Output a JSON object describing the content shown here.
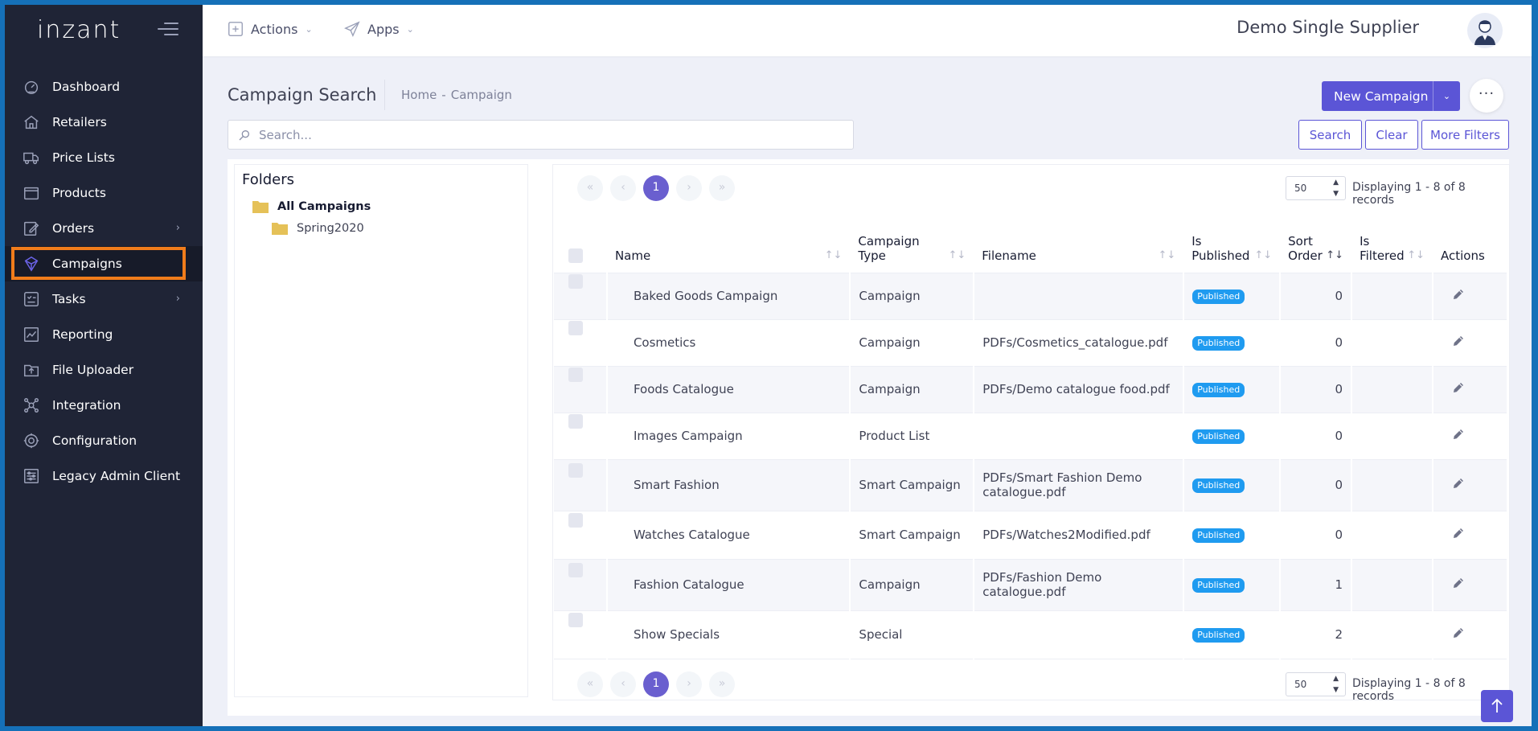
{
  "app": {
    "logo": "inzant"
  },
  "sidebar": {
    "items": [
      {
        "label": "Dashboard",
        "icon": "dashboard-icon",
        "has_sub": false
      },
      {
        "label": "Retailers",
        "icon": "home-icon",
        "has_sub": false
      },
      {
        "label": "Price Lists",
        "icon": "truck-icon",
        "has_sub": false
      },
      {
        "label": "Products",
        "icon": "box-icon",
        "has_sub": false
      },
      {
        "label": "Orders",
        "icon": "edit-icon",
        "has_sub": true
      },
      {
        "label": "Campaigns",
        "icon": "campaign-icon",
        "has_sub": false,
        "active": true
      },
      {
        "label": "Tasks",
        "icon": "tasks-icon",
        "has_sub": true
      },
      {
        "label": "Reporting",
        "icon": "chart-icon",
        "has_sub": false
      },
      {
        "label": "File Uploader",
        "icon": "upload-icon",
        "has_sub": false
      },
      {
        "label": "Integration",
        "icon": "integration-icon",
        "has_sub": false
      },
      {
        "label": "Configuration",
        "icon": "gear-icon",
        "has_sub": false
      },
      {
        "label": "Legacy Admin Client",
        "icon": "sliders-icon",
        "has_sub": false
      }
    ]
  },
  "header": {
    "actions_label": "Actions",
    "apps_label": "Apps",
    "user_name": "Demo Single Supplier"
  },
  "page": {
    "title": "Campaign Search",
    "breadcrumb": [
      "Home",
      "Campaign"
    ],
    "new_button": "New Campaign",
    "more_button": "···",
    "search_placeholder": "Search...",
    "search_button": "Search",
    "clear_button": "Clear",
    "filters_button": "More Filters"
  },
  "folders": {
    "title": "Folders",
    "root": "All Campaigns",
    "children": [
      "Spring2020"
    ]
  },
  "table": {
    "current_page": "1",
    "per_page": "50",
    "records_text": "Displaying 1 - 8 of 8 records",
    "columns": {
      "name": "Name",
      "type": [
        "Campaign",
        "Type"
      ],
      "filename": "Filename",
      "published": [
        "Is",
        "Published"
      ],
      "sort": [
        "Sort",
        "Order"
      ],
      "filtered": [
        "Is",
        "Filtered"
      ],
      "actions": "Actions"
    },
    "rows": [
      {
        "name": "Baked Goods Campaign",
        "type": "Campaign",
        "filename": [
          "",
          ""
        ],
        "status": "Published",
        "sort": "0",
        "filtered": ""
      },
      {
        "name": "Cosmetics",
        "type": "Campaign",
        "filename": [
          "PDFs/Cosmetics_catalogue.pdf",
          ""
        ],
        "status": "Published",
        "sort": "0",
        "filtered": ""
      },
      {
        "name": "Foods Catalogue",
        "type": "Campaign",
        "filename": [
          "PDFs/Demo catalogue food.pdf",
          ""
        ],
        "status": "Published",
        "sort": "0",
        "filtered": ""
      },
      {
        "name": "Images Campaign",
        "type": "Product List",
        "filename": [
          "",
          ""
        ],
        "status": "Published",
        "sort": "0",
        "filtered": ""
      },
      {
        "name": "Smart Fashion",
        "type": "Smart Campaign",
        "filename": [
          "PDFs/Smart Fashion Demo",
          "catalogue.pdf"
        ],
        "status": "Published",
        "sort": "0",
        "filtered": ""
      },
      {
        "name": "Watches Catalogue",
        "type": "Smart Campaign",
        "filename": [
          "PDFs/Watches2Modified.pdf",
          ""
        ],
        "status": "Published",
        "sort": "0",
        "filtered": ""
      },
      {
        "name": "Fashion Catalogue",
        "type": "Campaign",
        "filename": [
          "PDFs/Fashion Demo",
          "catalogue.pdf"
        ],
        "status": "Published",
        "sort": "1",
        "filtered": ""
      },
      {
        "name": "Show Specials",
        "type": "Special",
        "filename": [
          "",
          ""
        ],
        "status": "Published",
        "sort": "2",
        "filtered": ""
      }
    ]
  },
  "colors": {
    "sidebar_bg": "#1f2436",
    "primary": "#5b55d6",
    "highlight": "#f07c1b",
    "badge": "#1f9bf0"
  }
}
